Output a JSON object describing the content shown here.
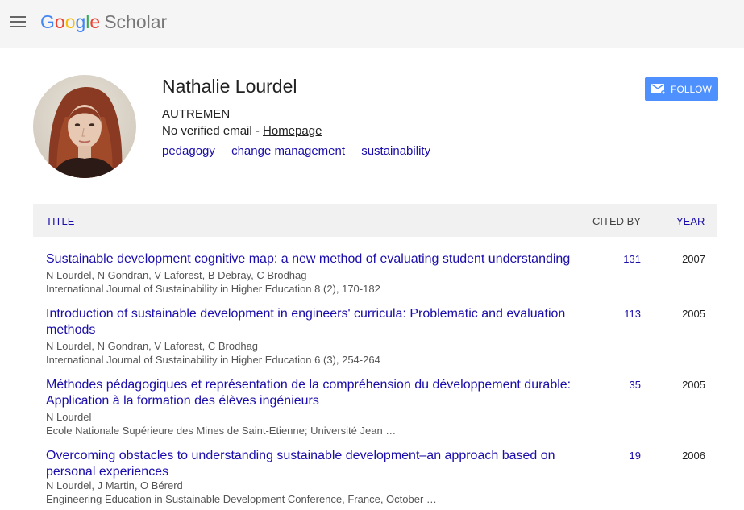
{
  "header": {
    "logo_google": [
      "G",
      "o",
      "o",
      "g",
      "l",
      "e"
    ],
    "logo_scholar": "Scholar"
  },
  "profile": {
    "name": "Nathalie Lourdel",
    "affiliation": "AUTREMEN",
    "email_text": "No verified email - ",
    "homepage_label": "Homepage",
    "interests": [
      "pedagogy",
      "change management",
      "sustainability"
    ],
    "follow_label": "FOLLOW"
  },
  "table": {
    "col_title": "TITLE",
    "col_cited": "CITED BY",
    "col_year": "YEAR",
    "rows": [
      {
        "title": "Sustainable development cognitive map: a new method of evaluating student understanding",
        "authors": "N Lourdel, N Gondran, V Laforest, B Debray, C Brodhag",
        "venue": "International Journal of Sustainability in Higher Education 8 (2), 170-182",
        "cited": "131",
        "year": "2007"
      },
      {
        "title": "Introduction of sustainable development in engineers' curricula: Problematic and evaluation methods",
        "authors": "N Lourdel, N Gondran, V Laforest, C Brodhag",
        "venue": "International Journal of Sustainability in Higher Education 6 (3), 254-264",
        "cited": "113",
        "year": "2005"
      },
      {
        "title": "Méthodes pédagogiques et représentation de la compréhension du développement durable: Application à la formation des élèves ingénieurs",
        "authors": "N Lourdel",
        "venue": "Ecole Nationale Supérieure des Mines de Saint-Etienne; Université Jean …",
        "cited": "35",
        "year": "2005"
      },
      {
        "title": "Overcoming obstacles to understanding sustainable development–an approach based on personal experiences",
        "authors": "N Lourdel, J Martin, O Bérerd",
        "venue": "Engineering Education in Sustainable Development Conference, France, October …",
        "cited": "19",
        "year": "2006"
      }
    ]
  },
  "colors": {
    "link": "#1a0dab",
    "follow_bg": "#4d90fe",
    "topbar_bg": "#f5f5f5",
    "table_header_bg": "#f1f1f1"
  }
}
